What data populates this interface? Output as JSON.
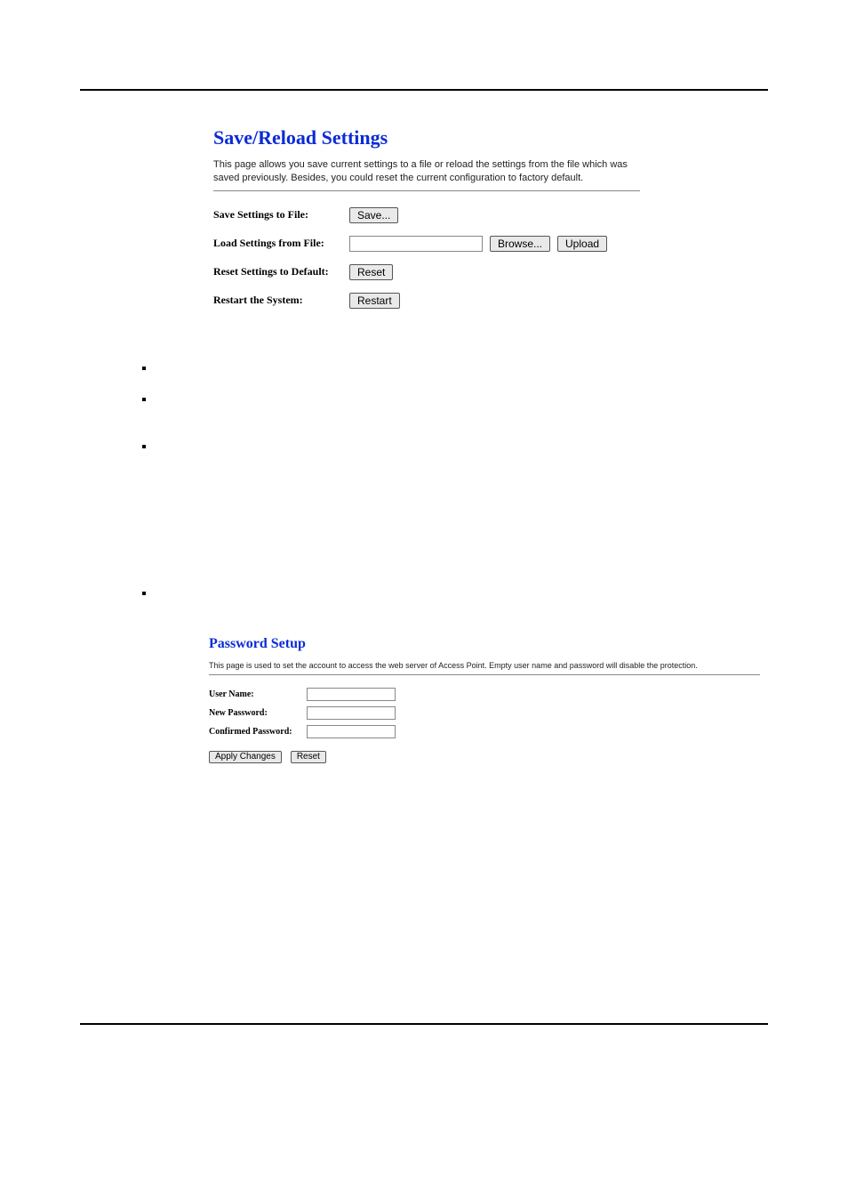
{
  "section1": {
    "title": "Save/Reload Settings",
    "description": "This page allows you save current settings to a file or reload the settings from the file which was saved previously. Besides, you could reset the current configuration to factory default.",
    "rows": {
      "save": {
        "label": "Save Settings to File:",
        "button": "Save..."
      },
      "load": {
        "label": "Load Settings from File:",
        "browse": "Browse...",
        "upload": "Upload"
      },
      "reset": {
        "label": "Reset Settings to Default:",
        "button": "Reset"
      },
      "restart": {
        "label": "Restart the System:",
        "button": "Restart"
      }
    }
  },
  "section2": {
    "title": "Password Setup",
    "description": "This page is used to set the account to access the web server of Access Point. Empty user name and password will disable the protection.",
    "fields": {
      "user": {
        "label": "User Name:"
      },
      "newpw": {
        "label": "New Password:"
      },
      "confirm": {
        "label": "Confirmed Password:"
      }
    },
    "buttons": {
      "apply": "Apply Changes",
      "reset": "Reset"
    }
  }
}
